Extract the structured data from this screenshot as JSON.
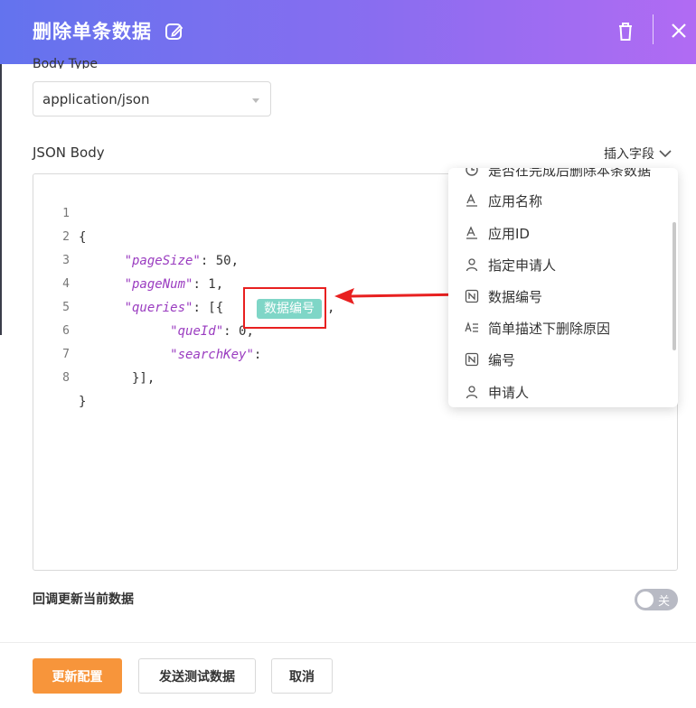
{
  "header": {
    "title": "删除单条数据"
  },
  "body_type": {
    "label": "Body Type",
    "value": "application/json"
  },
  "json_body": {
    "label": "JSON Body",
    "insert_field_label": "插入字段",
    "lines": [
      {
        "n": "1",
        "text": "{"
      },
      {
        "n": "2",
        "indent": "      ",
        "key": "\"pageSize\"",
        "rest": ": 50,"
      },
      {
        "n": "3",
        "indent": "      ",
        "key": "\"pageNum\"",
        "rest": ": 1,"
      },
      {
        "n": "4",
        "indent": "      ",
        "key": "\"queries\"",
        "rest": ": [{"
      },
      {
        "n": "5",
        "indent": "            ",
        "key": "\"queId\"",
        "rest": ": 0,"
      },
      {
        "n": "6",
        "indent": "            ",
        "key": "\"searchKey\"",
        "rest": ":"
      },
      {
        "n": "7",
        "text": "       }],"
      },
      {
        "n": "8",
        "text": "}"
      }
    ],
    "inserted_tag": "数据编号",
    "after_tag": ","
  },
  "field_menu": {
    "items": [
      {
        "icon": "clock-icon",
        "label": "是否在完成后删除本条数据"
      },
      {
        "icon": "text-field-icon",
        "label": "应用名称"
      },
      {
        "icon": "text-field-icon",
        "label": "应用ID"
      },
      {
        "icon": "user-icon",
        "label": "指定申请人"
      },
      {
        "icon": "number-field-icon",
        "label": "数据编号"
      },
      {
        "icon": "multiline-text-icon",
        "label": "简单描述下删除原因"
      },
      {
        "icon": "number-field-icon",
        "label": "编号"
      },
      {
        "icon": "user-icon",
        "label": "申请人"
      }
    ]
  },
  "callback": {
    "label": "回调更新当前数据",
    "toggle_text": "关",
    "enabled": false
  },
  "footer": {
    "primary": "更新配置",
    "send_test": "发送测试数据",
    "cancel": "取消"
  },
  "colors": {
    "accent": "#f7953b",
    "header_start": "#6373ee",
    "header_end": "#b16bf3",
    "tag": "#7fd6c7",
    "annotation": "#e82020"
  }
}
